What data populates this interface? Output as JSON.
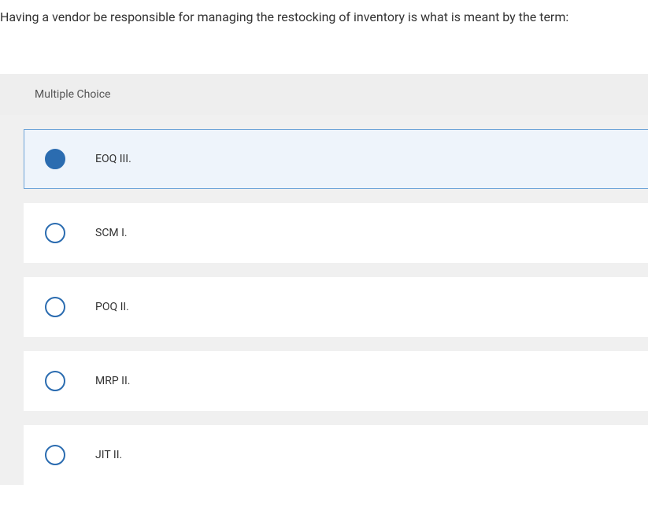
{
  "question": "Having a vendor be responsible for managing the restocking of inventory is what is meant by the term:",
  "section_label": "Multiple Choice",
  "options": [
    {
      "label": "EOQ III.",
      "selected": true
    },
    {
      "label": "SCM I.",
      "selected": false
    },
    {
      "label": "POQ II.",
      "selected": false
    },
    {
      "label": "MRP II.",
      "selected": false
    },
    {
      "label": "JIT II.",
      "selected": false
    }
  ]
}
